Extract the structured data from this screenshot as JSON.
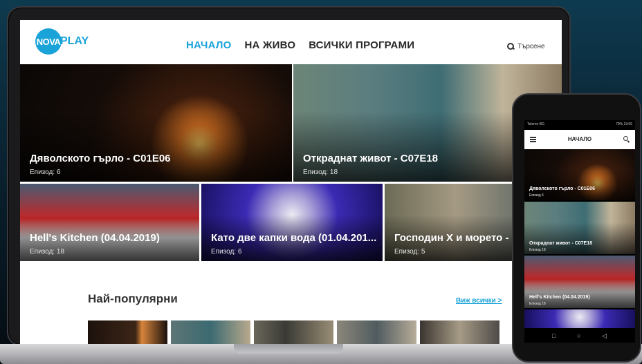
{
  "header": {
    "logo_mark": "NOVA",
    "logo_text": "PLAY",
    "menu": [
      "НАЧАЛО",
      "НА ЖИВО",
      "ВСИЧКИ ПРОГРАМИ"
    ],
    "search_label": "Търсене"
  },
  "tiles": [
    {
      "title": "Дяволското гърло - C01E06",
      "sub": "Епизод: 6"
    },
    {
      "title": "Откраднат живот - C07E18",
      "sub": "Епизод: 18"
    },
    {
      "title": "Hell's Kitchen (04.04.2019)",
      "sub": "Епизод: 18"
    },
    {
      "title": "Като две капки вода (01.04.201...",
      "sub": "Епизод: 6"
    },
    {
      "title": "Господин Х и морето -",
      "sub": "Епизод: 5"
    }
  ],
  "popular": {
    "title": "Най-популярни",
    "link": "Виж всички >"
  },
  "phone": {
    "status_left": "Telenor BG",
    "status_right": "79% 13:05",
    "title": "НАЧАЛО",
    "tiles": [
      {
        "title": "Дяволското гърло - C01E06",
        "sub": "Епизод 6"
      },
      {
        "title": "Откраднат живот - C07E18",
        "sub": "Епизод 18"
      },
      {
        "title": "Hell's Kitchen (04.04.2019)",
        "sub": "Епизод 18"
      }
    ],
    "nav": [
      "□",
      "○",
      "◁"
    ]
  },
  "colors": {
    "accent": "#1aa3d9"
  }
}
